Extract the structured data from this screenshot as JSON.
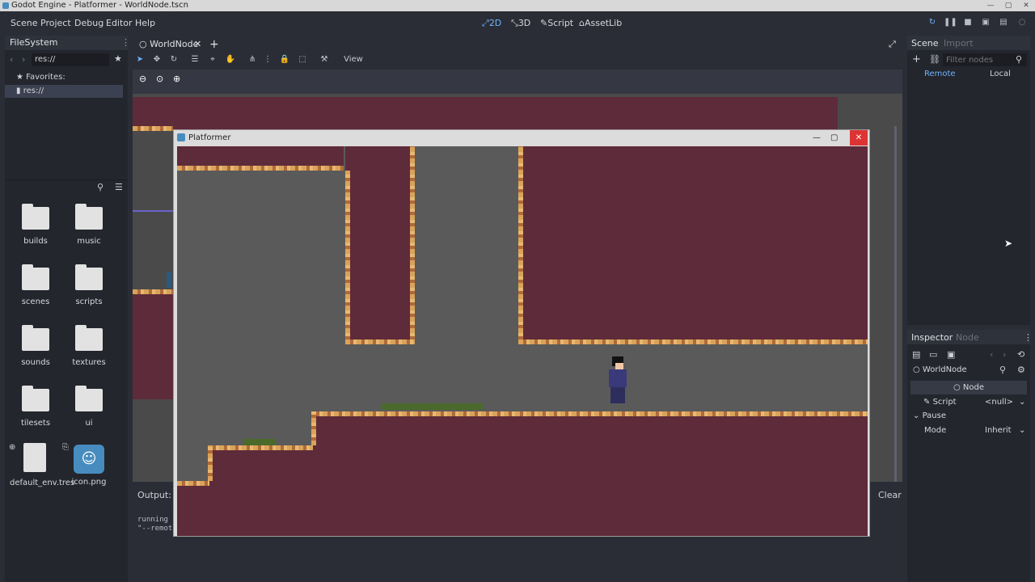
{
  "window": {
    "title": "Godot Engine - Platformer - WorldNode.tscn"
  },
  "menu": [
    "Scene",
    "Project",
    "Debug",
    "Editor",
    "Help"
  ],
  "workspaces": [
    {
      "label": "2D",
      "icon": "2d-icon",
      "active": true
    },
    {
      "label": "3D",
      "icon": "3d-icon",
      "active": false
    },
    {
      "label": "Script",
      "icon": "script-icon",
      "active": false
    },
    {
      "label": "AssetLib",
      "icon": "assetlib-icon",
      "active": false
    }
  ],
  "filesystem": {
    "tab": "FileSystem",
    "path": "res://",
    "favorites": "Favorites:",
    "root": "res://",
    "items": [
      {
        "name": "builds",
        "type": "folder"
      },
      {
        "name": "music",
        "type": "folder"
      },
      {
        "name": "scenes",
        "type": "folder"
      },
      {
        "name": "scripts",
        "type": "folder"
      },
      {
        "name": "sounds",
        "type": "folder"
      },
      {
        "name": "textures",
        "type": "folder"
      },
      {
        "name": "tilesets",
        "type": "folder"
      },
      {
        "name": "ui",
        "type": "folder"
      },
      {
        "name": "default_env.tres",
        "type": "file"
      },
      {
        "name": "icon.png",
        "type": "image"
      }
    ]
  },
  "editor": {
    "scene_tab": "WorldNode",
    "view_menu": "View"
  },
  "output": {
    "label": "Output:",
    "clear": "Clear",
    "lines": [
      "running",
      "\"--remot"
    ]
  },
  "scene_dock": {
    "tabs": [
      "Scene",
      "Import"
    ],
    "filter_placeholder": "Filter nodes",
    "remote": "Remote",
    "local": "Local"
  },
  "inspector": {
    "tabs": [
      "Inspector",
      "Node"
    ],
    "node_name": "WorldNode",
    "section": "Node",
    "script_label": "Script",
    "script_value": "<null>",
    "pause_label": "Pause",
    "mode_label": "Mode",
    "mode_value": "Inherit"
  },
  "game_window": {
    "title": "Platformer"
  },
  "colors": {
    "accent": "#6fb3ff",
    "dirt": "#5e2b3a",
    "edge": "#d9a35a"
  }
}
